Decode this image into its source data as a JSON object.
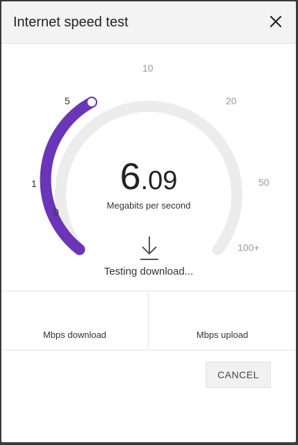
{
  "dialog": {
    "title": "Internet speed test",
    "close_icon": "close-icon"
  },
  "gauge": {
    "ticks": {
      "t0": "0",
      "t1": "1",
      "t5": "5",
      "t10": "10",
      "t20": "20",
      "t50": "50",
      "t100": "100+"
    },
    "speed_integer": "6",
    "speed_decimal": ".09",
    "speed_value": 6.09,
    "unit_label": "Megabits per second",
    "download_icon": "download-arrow-icon",
    "status": "Testing download...",
    "colors": {
      "progress": "#6a35b9",
      "track": "#ececec"
    }
  },
  "results": {
    "download_label": "Mbps download",
    "upload_label": "Mbps upload"
  },
  "actions": {
    "cancel_label": "CANCEL"
  }
}
